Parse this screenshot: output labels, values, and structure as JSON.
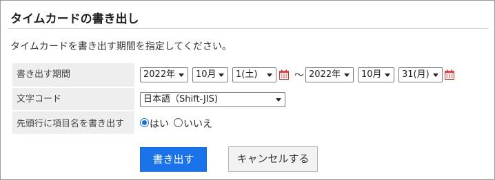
{
  "page": {
    "title": "タイムカードの書き出し",
    "description": "タイムカードを書き出す期間を指定してください。"
  },
  "form": {
    "period": {
      "label": "書き出す期間",
      "from": {
        "year": "2022年",
        "month": "10月",
        "day": "1(土)"
      },
      "separator": "～",
      "to": {
        "year": "2022年",
        "month": "10月",
        "day": "31(月)"
      }
    },
    "encoding": {
      "label": "文字コード",
      "selected": "日本語（Shift-JIS)"
    },
    "header_row": {
      "label": "先頭行に項目名を書き出す",
      "options": [
        {
          "label": "はい",
          "checked": true
        },
        {
          "label": "いいえ",
          "checked": false
        }
      ]
    }
  },
  "actions": {
    "export": "書き出す",
    "cancel": "キャンセルする"
  },
  "colors": {
    "primary": "#1a73e8",
    "label_bg": "#eeeeee",
    "calendar_red": "#d9534f"
  },
  "icons": {
    "calendar": "calendar-icon",
    "dropdown": "chevron-down-icon",
    "radio": "radio-icon"
  }
}
